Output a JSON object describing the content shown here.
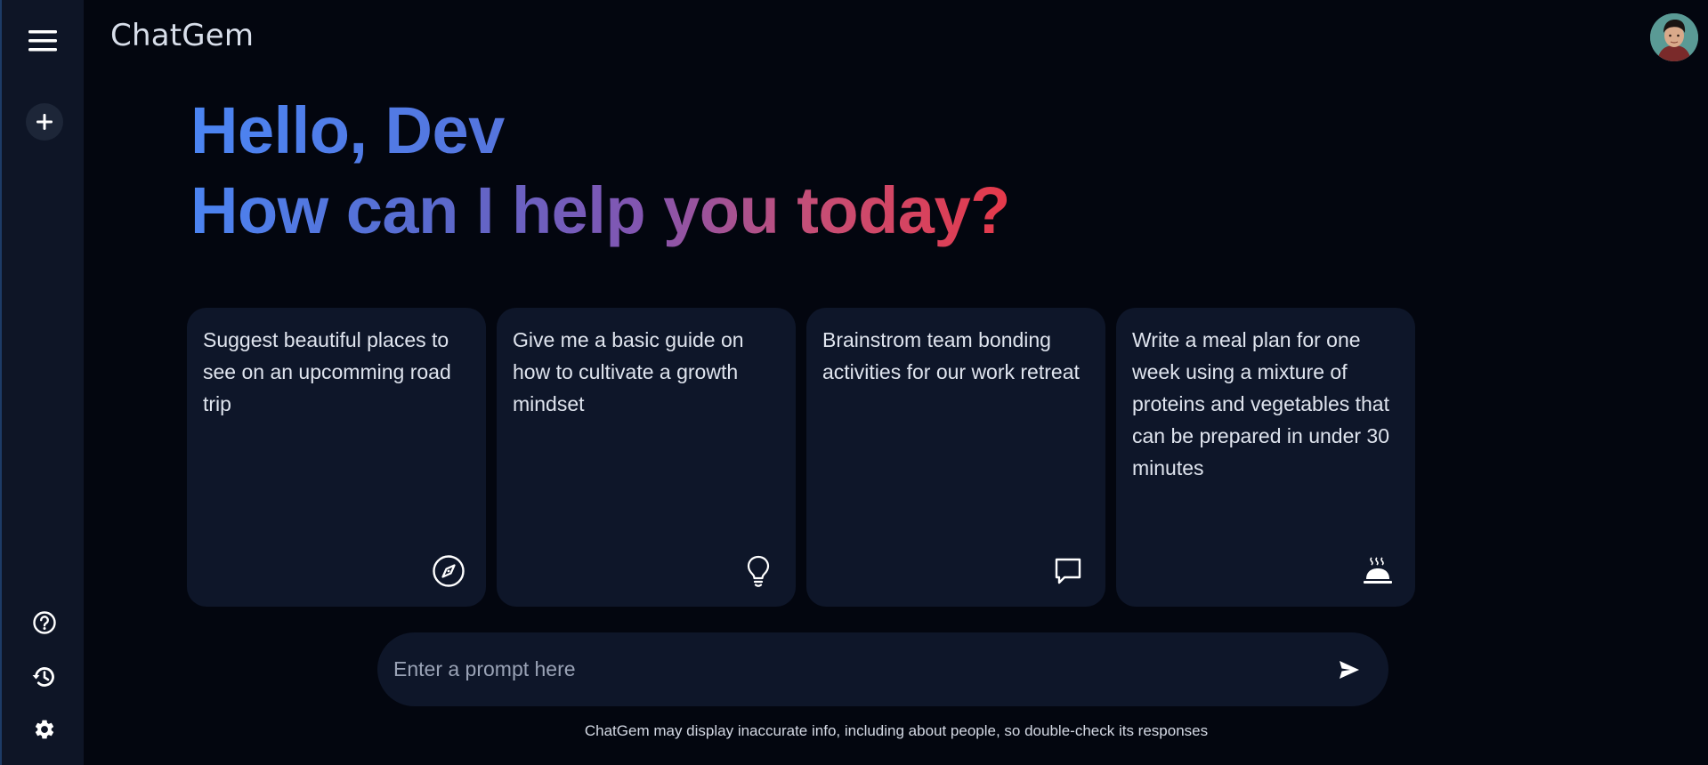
{
  "app": {
    "brand": "ChatGem"
  },
  "sidebar": {
    "menu_icon": "hamburger-menu-icon",
    "new_chat_icon": "plus-icon",
    "bottom": [
      {
        "icon": "help-icon"
      },
      {
        "icon": "history-icon"
      },
      {
        "icon": "gear-icon"
      }
    ]
  },
  "greeting": {
    "line1": "Hello, Dev",
    "line2": "How can I help you today?"
  },
  "cards": [
    {
      "text": "Suggest beautiful places to see on an upcomming road trip",
      "icon": "compass-icon"
    },
    {
      "text": "Give me a basic guide on how to cultivate a growth mindset",
      "icon": "lightbulb-icon"
    },
    {
      "text": "Brainstrom team bonding activities for our work retreat",
      "icon": "chat-bubble-icon"
    },
    {
      "text": "Write a meal plan for one week using a mixture of proteins and vegetables that can be prepared in under 30 minutes",
      "icon": "food-tray-icon"
    }
  ],
  "prompt": {
    "placeholder": "Enter a prompt here",
    "value": "",
    "send_icon": "send-icon"
  },
  "disclaimer": "ChatGem may display inaccurate info, including about people, so double-check its responses"
}
